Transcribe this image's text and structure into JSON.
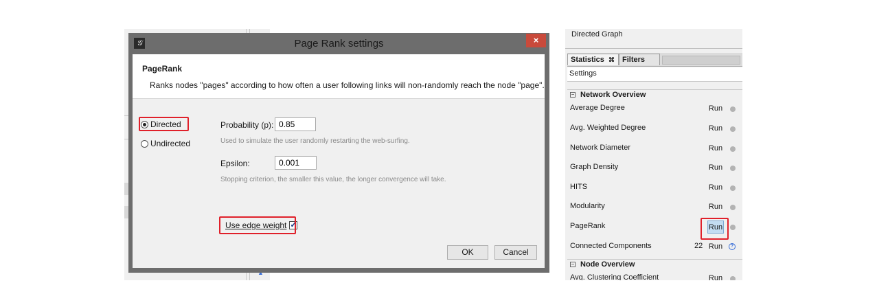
{
  "dialog": {
    "title": "Page Rank settings",
    "close_glyph": "×",
    "app_icon": "𝒢",
    "algorithm_name": "PageRank",
    "description": "Ranks nodes \"pages\" according to how often a user following links will non-randomly reach the node \"page\".",
    "directed_label": "Directed",
    "undirected_label": "Undirected",
    "selected_mode": "Directed",
    "probability_label": "Probability (p):",
    "probability_value": "0.85",
    "probability_hint": "Used to simulate the user randomly restarting the web-surfing.",
    "epsilon_label": "Epsilon:",
    "epsilon_value": "0.001",
    "epsilon_hint": "Stopping criterion, the smaller this value, the longer convergence will take.",
    "edge_weight_label": "Use edge weight",
    "edge_weight_checked": true,
    "ok_label": "OK",
    "cancel_label": "Cancel"
  },
  "right_panel": {
    "graph_type": "Directed Graph",
    "tabs": [
      {
        "label": "Statistics",
        "close_glyph": "⌘"
      },
      {
        "label": "Filters"
      }
    ],
    "settings_label": "Settings",
    "network_overview_title": "Network Overview",
    "node_overview_title": "Node Overview",
    "toggle_glyph": "−",
    "stats": [
      {
        "label": "Average Degree",
        "run": "Run",
        "value": ""
      },
      {
        "label": "Avg. Weighted Degree",
        "run": "Run",
        "value": ""
      },
      {
        "label": "Network Diameter",
        "run": "Run",
        "value": ""
      },
      {
        "label": "Graph Density",
        "run": "Run",
        "value": ""
      },
      {
        "label": "HITS",
        "run": "Run",
        "value": ""
      },
      {
        "label": "Modularity",
        "run": "Run",
        "value": ""
      },
      {
        "label": "PageRank",
        "run": "Run",
        "value": ""
      },
      {
        "label": "Connected Components",
        "run": "Run",
        "value": "22"
      }
    ],
    "node_stats": [
      {
        "label": "Avg. Clustering Coefficient",
        "run": "Run"
      }
    ],
    "info_glyph": "?"
  },
  "colors": {
    "highlight_red": "#e0202a",
    "close_button": "#c94a3b",
    "run_active": "#c3dcf2"
  }
}
